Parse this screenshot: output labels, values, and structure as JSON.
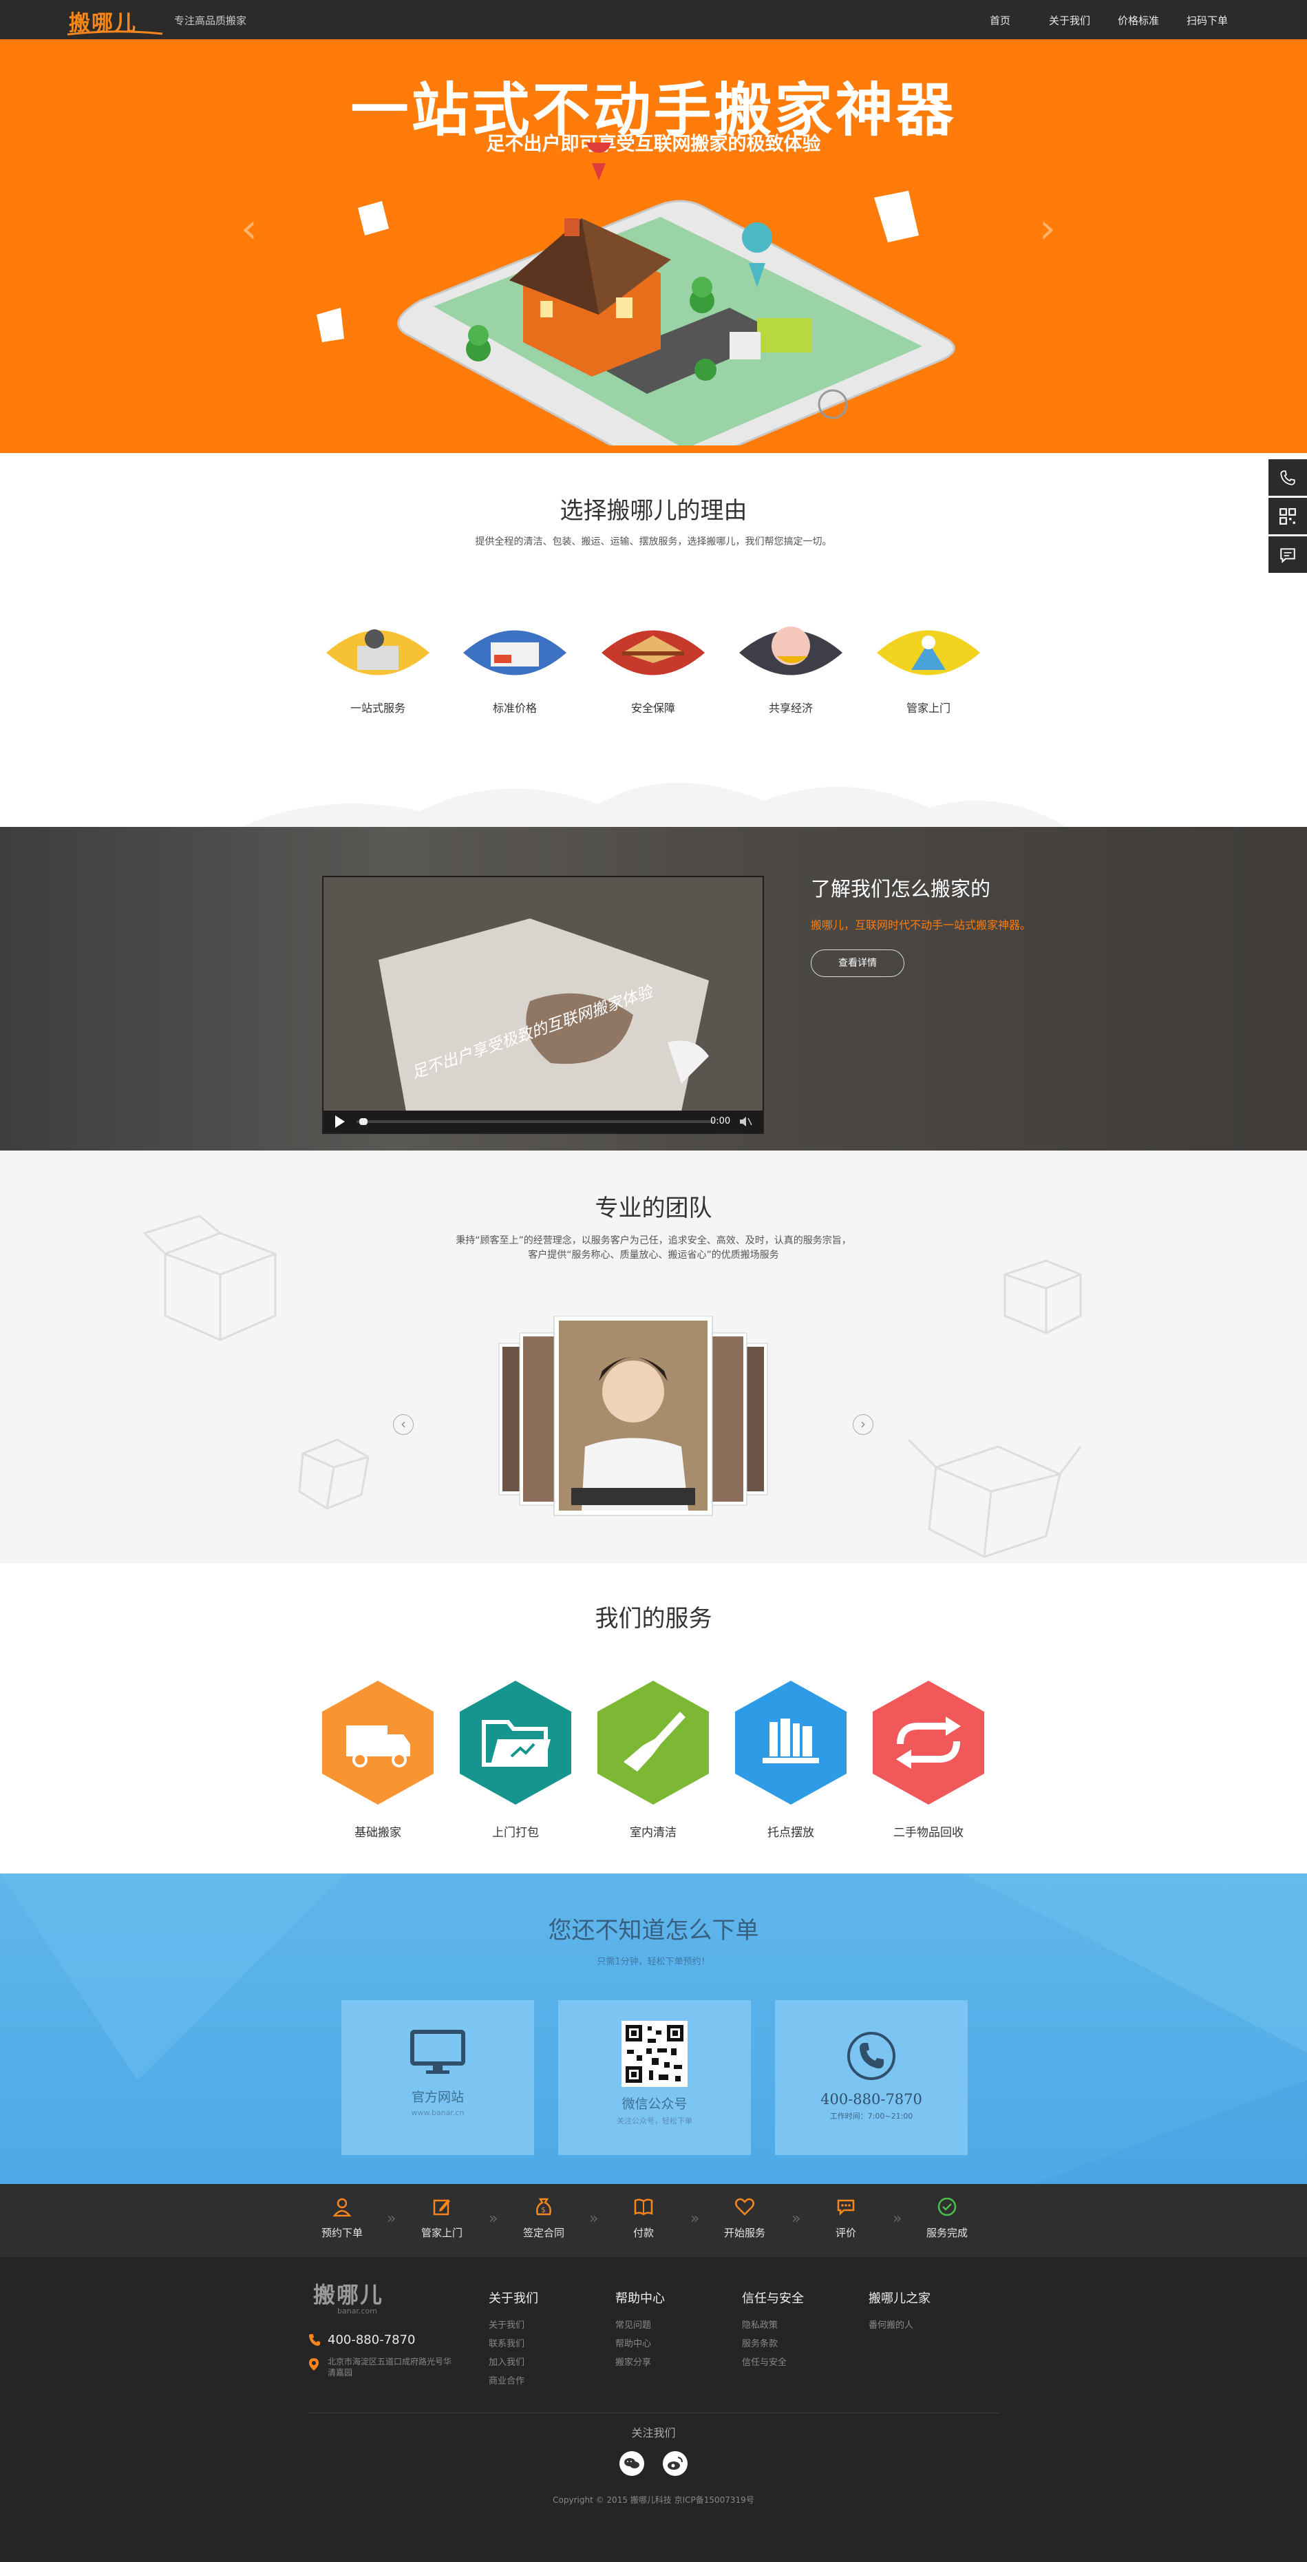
{
  "header": {
    "logo": "搬哪儿",
    "slogan": "专注高品质搬家",
    "nav": [
      {
        "label": "首页"
      },
      {
        "label": "关于我们"
      },
      {
        "label": "价格标准"
      },
      {
        "label": "扫码下单"
      }
    ]
  },
  "hero": {
    "title": "一站式不动手搬家神器",
    "subtitle": "足不出户即可享受互联网搬家的极致体验"
  },
  "reasons": {
    "title": "选择搬哪儿的理由",
    "subtitle": "提供全程的清洁、包装、搬运、运输、摆放服务，选择搬哪儿，我们帮您搞定一切。",
    "items": [
      {
        "label": "一站式服务"
      },
      {
        "label": "标准价格"
      },
      {
        "label": "安全保障"
      },
      {
        "label": "共享经济"
      },
      {
        "label": "管家上门"
      }
    ]
  },
  "video": {
    "overlay_text": "足不出户享受极致的互联网搬家体验",
    "time": "0:00",
    "title": "了解我们怎么搬家的",
    "desc": "搬哪儿，互联网时代不动手一站式搬家神器。",
    "button": "查看详情"
  },
  "team": {
    "title": "专业的团队",
    "desc1": "秉持“顾客至上”的经营理念，以服务客户为己任，追求安全、高效、及时，认真的服务宗旨，",
    "desc2": "客户提供“服务称心、质量放心、搬运省心”的优质搬场服务"
  },
  "services": {
    "title": "我们的服务",
    "items": [
      {
        "label": "基础搬家",
        "color": "#f89532",
        "icon": "truck-icon"
      },
      {
        "label": "上门打包",
        "color": "#15958e",
        "icon": "folder-icon"
      },
      {
        "label": "室内清洁",
        "color": "#7cb833",
        "icon": "brush-icon"
      },
      {
        "label": "托点摆放",
        "color": "#2d9be6",
        "icon": "books-icon"
      },
      {
        "label": "二手物品回收",
        "color": "#f0585a",
        "icon": "recycle-icon"
      }
    ]
  },
  "order": {
    "title": "您还不知道怎么下单",
    "subtitle": "只需1分钟，轻松下单预约！",
    "cards": [
      {
        "title": "官方网站",
        "sub": "www.banar.cn"
      },
      {
        "title": "微信公众号",
        "sub": "关注公众号，轻松下单"
      },
      {
        "title": "400-880-7870",
        "sub": "工作时间：7:00~21:00"
      }
    ]
  },
  "steps": [
    {
      "label": "预约下单"
    },
    {
      "label": "管家上门"
    },
    {
      "label": "签定合同"
    },
    {
      "label": "付款"
    },
    {
      "label": "开始服务"
    },
    {
      "label": "评价"
    },
    {
      "label": "服务完成"
    }
  ],
  "footer": {
    "logo": "搬哪儿",
    "logo_sub": "banar.com",
    "phone": "400-880-7870",
    "address": "北京市海淀区五道口成府路光号华清嘉园",
    "cols": [
      {
        "title": "关于我们",
        "links": [
          "关于我们",
          "联系我们",
          "加入我们",
          "商业合作"
        ]
      },
      {
        "title": "帮助中心",
        "links": [
          "常见问题",
          "帮助中心",
          "搬家分享"
        ]
      },
      {
        "title": "信任与安全",
        "links": [
          "隐私政策",
          "服务条款",
          "信任与安全"
        ]
      },
      {
        "title": "搬哪儿之家",
        "links": [
          "番何搬的人"
        ]
      }
    ],
    "follow": "关注我们",
    "copyright": "Copyright © 2015 搬哪儿科技 京ICP备15007319号"
  },
  "colors": {
    "accent": "#ff7c0a",
    "dark": "#2b2b2b",
    "blue": "#5fb6eb"
  }
}
